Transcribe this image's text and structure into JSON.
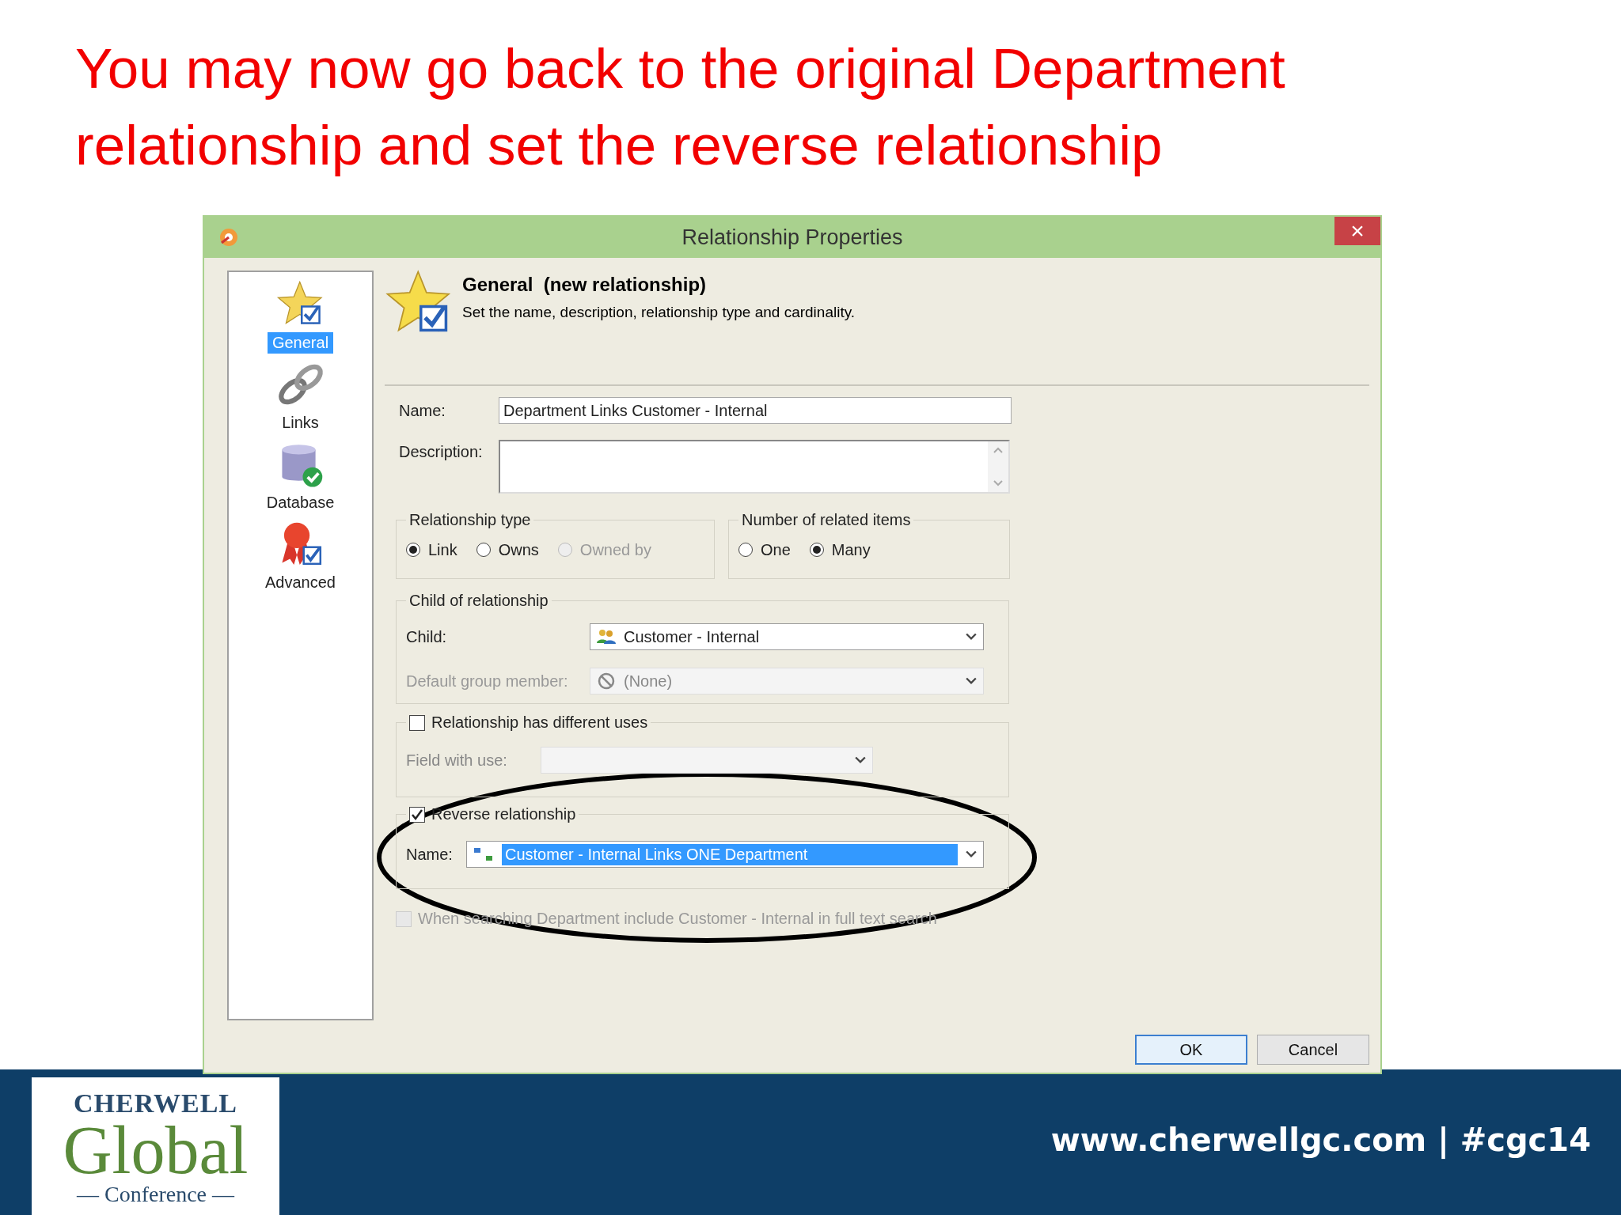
{
  "slide": {
    "title": "You may now go back to the original Department relationship and set the reverse relationship",
    "footer_text": "www.cherwellgc.com | #cgc14",
    "logo": {
      "line_1": "CHERWELL",
      "line_2": "Global",
      "line_3": "— Conference —"
    }
  },
  "window": {
    "title": "Relationship Properties",
    "close": "×"
  },
  "sidebar": {
    "items": [
      {
        "label": "General",
        "kind": "star",
        "selected": true
      },
      {
        "label": "Links",
        "kind": "links",
        "selected": false
      },
      {
        "label": "Database",
        "kind": "database",
        "selected": false
      },
      {
        "label": "Advanced",
        "kind": "advanced",
        "selected": false
      }
    ]
  },
  "header": {
    "title": "General  (new relationship)",
    "subtitle": "Set the name, description, relationship type and cardinality."
  },
  "name_field": {
    "label": "Name:",
    "value": "Department Links Customer - Internal"
  },
  "description_field": {
    "label": "Description:"
  },
  "relationship_type": {
    "legend": "Relationship type",
    "options": [
      {
        "label": "Link",
        "selected": true,
        "disabled": false
      },
      {
        "label": "Owns",
        "selected": false,
        "disabled": false
      },
      {
        "label": "Owned by",
        "selected": false,
        "disabled": true
      }
    ]
  },
  "related_items": {
    "legend": "Number of related items",
    "options": [
      {
        "label": "One",
        "selected": false,
        "disabled": false
      },
      {
        "label": "Many",
        "selected": true,
        "disabled": false
      }
    ]
  },
  "child_group": {
    "legend": "Child of relationship",
    "rows": [
      {
        "label": "Child:",
        "value": "Customer - Internal",
        "kind": "people",
        "disabled": false
      },
      {
        "label": "Default group member:",
        "value": "(None)",
        "kind": "none",
        "disabled": true
      }
    ]
  },
  "uses_group": {
    "label": "Relationship has different uses",
    "checked": false,
    "field_label": "Field with use:"
  },
  "reverse_group": {
    "label": "Reverse relationship",
    "checked": true,
    "name_label": "Name:",
    "name_value": "Customer - Internal Links ONE Department"
  },
  "search_option": {
    "label": "When searching Department include Customer - Internal in full text search",
    "checked": false,
    "disabled": true
  },
  "buttons": [
    {
      "label": "OK",
      "kind": "default"
    },
    {
      "label": "Cancel",
      "kind": "normal"
    }
  ]
}
